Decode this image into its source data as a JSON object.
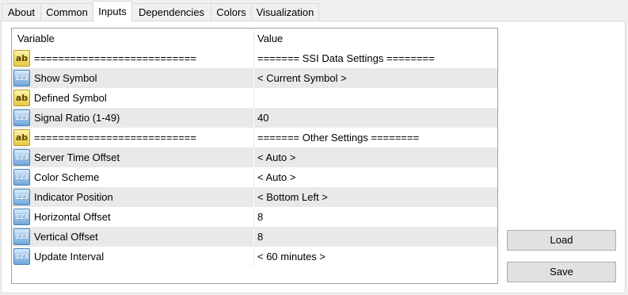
{
  "tabs": [
    {
      "label": "About"
    },
    {
      "label": "Common"
    },
    {
      "label": "Inputs"
    },
    {
      "label": "Dependencies"
    },
    {
      "label": "Colors"
    },
    {
      "label": "Visualization"
    }
  ],
  "active_tab": "Inputs",
  "grid": {
    "headers": {
      "variable": "Variable",
      "value": "Value"
    },
    "rows": [
      {
        "type": "ab",
        "variable": "===========================",
        "value": "======= SSI Data Settings ========"
      },
      {
        "type": "123",
        "variable": "Show Symbol",
        "value": "< Current Symbol >"
      },
      {
        "type": "ab",
        "variable": "Defined Symbol",
        "value": ""
      },
      {
        "type": "123",
        "variable": "Signal Ratio (1-49)",
        "value": "40"
      },
      {
        "type": "ab",
        "variable": "===========================",
        "value": "======= Other Settings ========"
      },
      {
        "type": "123",
        "variable": "Server Time Offset",
        "value": "< Auto >"
      },
      {
        "type": "123",
        "variable": "Color Scheme",
        "value": "< Auto >"
      },
      {
        "type": "123",
        "variable": "Indicator Position",
        "value": "< Bottom Left >"
      },
      {
        "type": "123",
        "variable": "Horizontal Offset",
        "value": "8"
      },
      {
        "type": "123",
        "variable": "Vertical Offset",
        "value": "8"
      },
      {
        "type": "123",
        "variable": "Update Interval",
        "value": "< 60 minutes >"
      }
    ]
  },
  "buttons": {
    "load": "Load",
    "save": "Save"
  },
  "icon_labels": {
    "ab": "ab",
    "num": "123"
  }
}
